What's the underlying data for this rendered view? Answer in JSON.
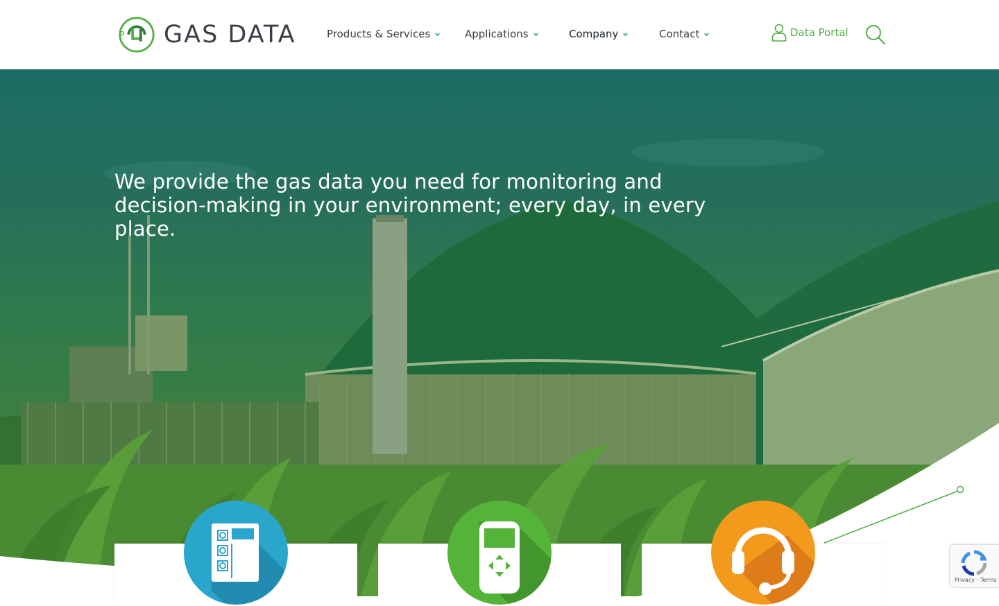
{
  "header": {
    "logo_text": "GAS DATA",
    "nav": [
      {
        "label": "Products & Services"
      },
      {
        "label": "Applications"
      },
      {
        "label": "Company"
      },
      {
        "label": "Contact"
      }
    ],
    "data_portal_label": "Data Portal"
  },
  "hero": {
    "title": "We provide the gas data you need for monitoring and decision-making in your environment; every day, in every place."
  },
  "cards": [
    {
      "icon": "device-panel-icon",
      "color": "#2aa6cc"
    },
    {
      "icon": "handheld-analyser-icon",
      "color": "#54b339"
    },
    {
      "icon": "support-headset-icon",
      "color": "#f39a1c"
    }
  ],
  "recaptcha": {
    "label": "Privacy - Terms"
  },
  "colors": {
    "brand_green": "#4caf42",
    "hero_teal": "#1c6d66"
  }
}
